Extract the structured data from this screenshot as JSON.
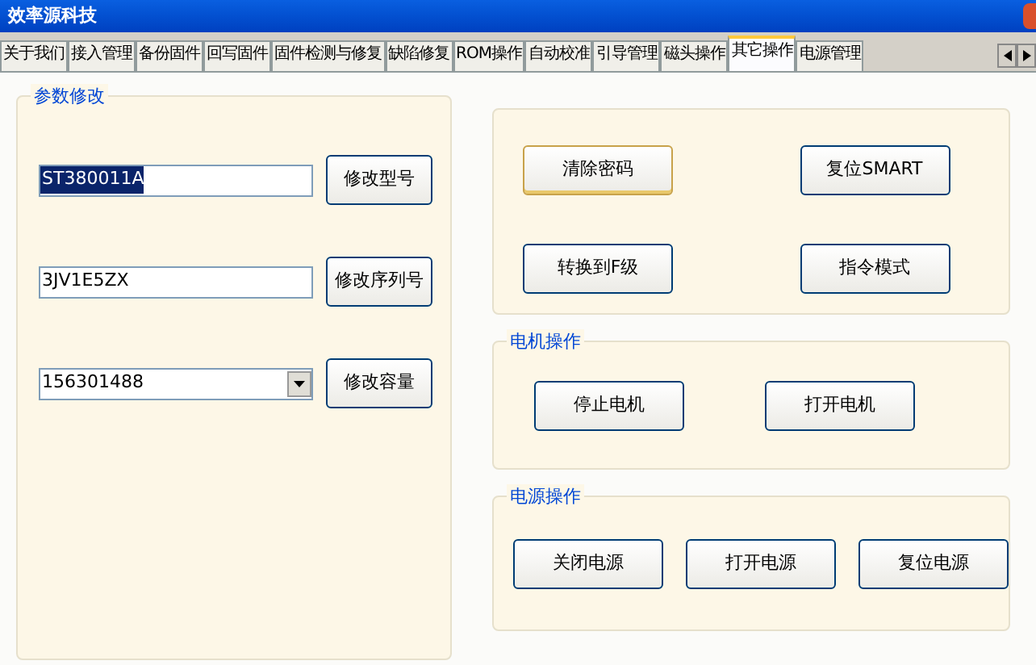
{
  "window": {
    "title": "效率源科技"
  },
  "tabs": [
    {
      "label": "关于我们",
      "selected": false
    },
    {
      "label": "接入管理",
      "selected": false
    },
    {
      "label": "备份固件",
      "selected": false
    },
    {
      "label": "回写固件",
      "selected": false
    },
    {
      "label": "固件检测与修复",
      "selected": false
    },
    {
      "label": "缺陷修复",
      "selected": false
    },
    {
      "label": "ROM操作",
      "selected": false
    },
    {
      "label": "自动校准",
      "selected": false
    },
    {
      "label": "引导管理",
      "selected": false
    },
    {
      "label": "磁头操作",
      "selected": false
    },
    {
      "label": "其它操作",
      "selected": true
    },
    {
      "label": "电源管理",
      "selected": false
    }
  ],
  "param_group": {
    "title": "参数修改",
    "rows": [
      {
        "kind": "text",
        "value": "ST380011A",
        "highlighted": true,
        "button": "修改型号"
      },
      {
        "kind": "text",
        "value": "3JV1E5ZX",
        "highlighted": false,
        "button": "修改序列号"
      },
      {
        "kind": "combo",
        "value": "156301488",
        "highlighted": false,
        "button": "修改容量"
      }
    ]
  },
  "misc_buttons": [
    {
      "label": "清除密码",
      "focused": true
    },
    {
      "label": "复位SMART",
      "focused": false
    },
    {
      "label": "转换到F级",
      "focused": false
    },
    {
      "label": "指令模式",
      "focused": false
    }
  ],
  "motor_group": {
    "title": "电机操作",
    "buttons": [
      "停止电机",
      "打开电机"
    ]
  },
  "power_group": {
    "title": "电源操作",
    "buttons": [
      "关闭电源",
      "打开电源",
      "复位电源"
    ]
  }
}
